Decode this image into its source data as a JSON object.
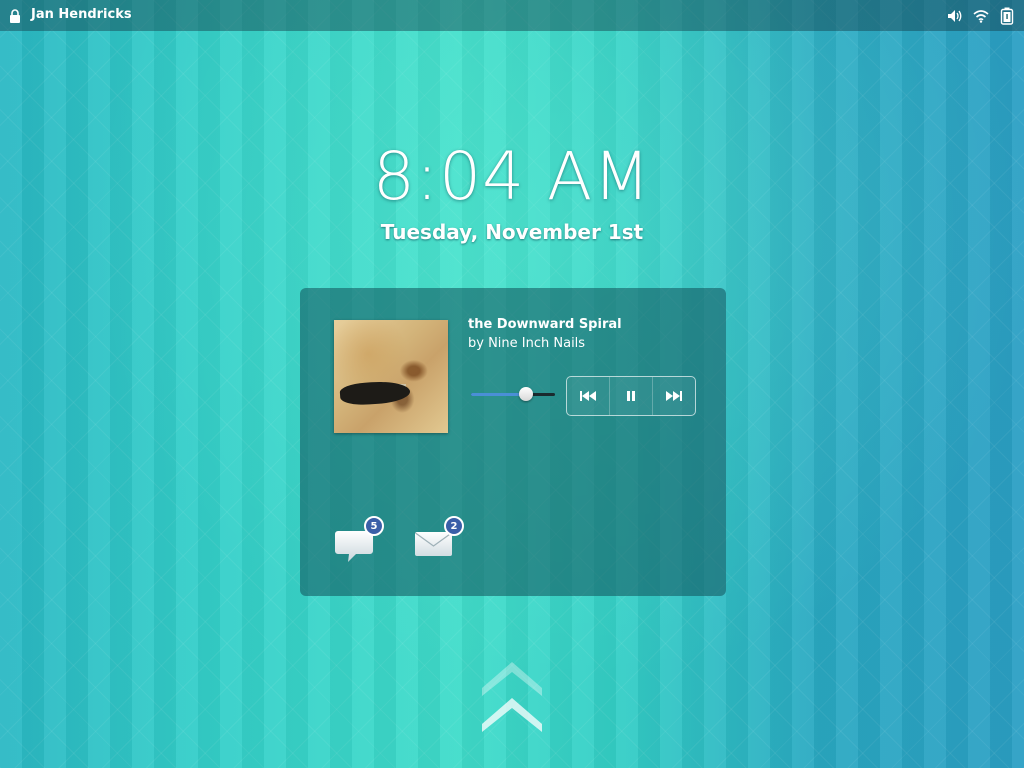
{
  "topbar": {
    "user_name": "Jan Hendricks",
    "icons": [
      "lock-icon",
      "volume-icon",
      "wifi-icon",
      "battery-icon"
    ]
  },
  "clock": {
    "time": "8:04 AM",
    "date": "Tuesday, November 1st"
  },
  "media": {
    "title": "the Downward Spiral",
    "artist": "by Nine Inch Nails",
    "progress": 0.66,
    "controls": [
      "previous-icon",
      "pause-icon",
      "next-icon"
    ]
  },
  "notifications": {
    "chat_count": "5",
    "mail_count": "2"
  },
  "unlock": {
    "icon": "chevron-up-icon"
  },
  "colors": {
    "background_teal": "#34cfc9",
    "panel": "#10505a",
    "badge_blue": "#3b5fa8",
    "slider_fill": "#4a8fd6"
  }
}
